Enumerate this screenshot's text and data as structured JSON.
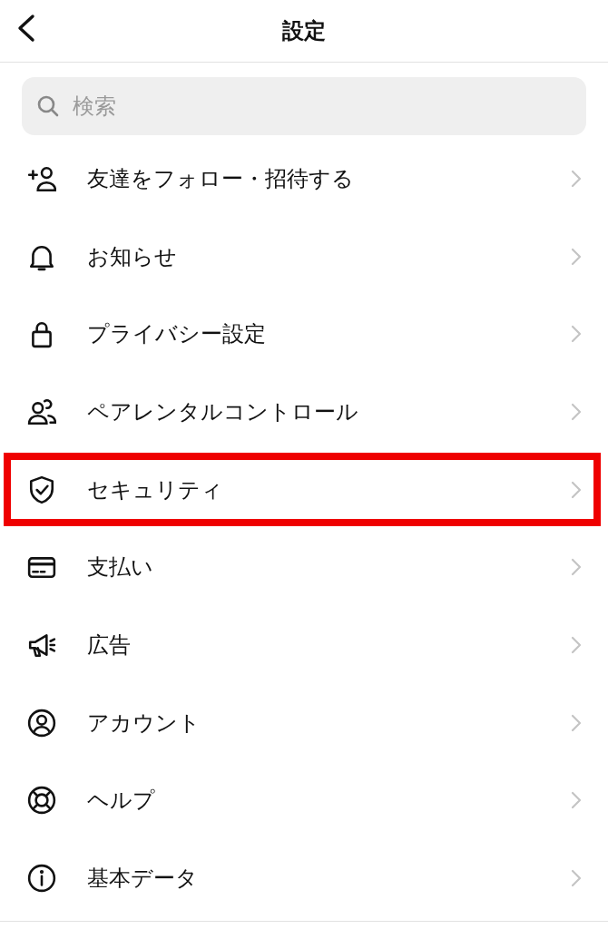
{
  "header": {
    "title": "設定"
  },
  "search": {
    "placeholder": "検索"
  },
  "items": [
    {
      "label": "友達をフォロー・招待する",
      "highlighted": false
    },
    {
      "label": "お知らせ",
      "highlighted": false
    },
    {
      "label": "プライバシー設定",
      "highlighted": false
    },
    {
      "label": "ペアレンタルコントロール",
      "highlighted": false
    },
    {
      "label": "セキュリティ",
      "highlighted": true
    },
    {
      "label": "支払い",
      "highlighted": false
    },
    {
      "label": "広告",
      "highlighted": false
    },
    {
      "label": "アカウント",
      "highlighted": false
    },
    {
      "label": "ヘルプ",
      "highlighted": false
    },
    {
      "label": "基本データ",
      "highlighted": false
    }
  ]
}
